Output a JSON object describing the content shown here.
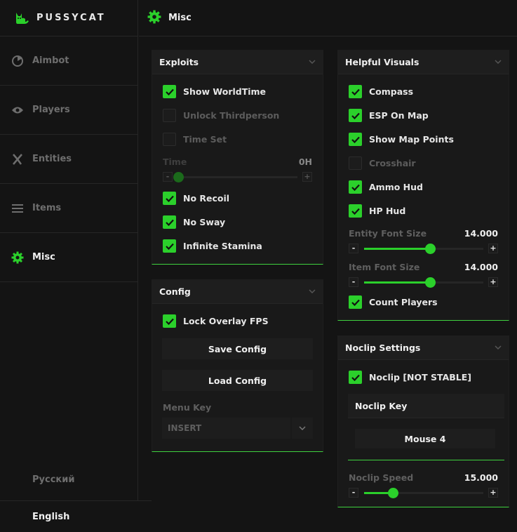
{
  "app": {
    "name": "PUSSYCAT",
    "accent": "#2bd02b"
  },
  "sidebar": {
    "items": [
      {
        "label": "Aimbot",
        "icon": "crosshair-icon"
      },
      {
        "label": "Players",
        "icon": "eye-icon"
      },
      {
        "label": "Entities",
        "icon": "entity-icon"
      },
      {
        "label": "Items",
        "icon": "list-icon"
      },
      {
        "label": "Misc",
        "icon": "gear-icon"
      }
    ],
    "languages": [
      "Русский",
      "English"
    ]
  },
  "header": {
    "title": "Misc"
  },
  "exploits": {
    "title": "Exploits",
    "show_worldtime": "Show WorldTime",
    "unlock_thirdperson": "Unlock Thirdperson",
    "time_set": "Time Set",
    "time_label": "Time",
    "time_value": "0H",
    "time_level": 0,
    "no_recoil": "No Recoil",
    "no_sway": "No Sway",
    "infinite_stamina": "Infinite Stamina"
  },
  "config": {
    "title": "Config",
    "lock_overlay_fps": "Lock Overlay FPS",
    "save_config": "Save Config",
    "load_config": "Load Config",
    "menu_key_label": "Menu Key",
    "menu_key_value": "INSERT"
  },
  "visuals": {
    "title": "Helpful Visuals",
    "compass": "Compass",
    "esp_on_map": "ESP On Map",
    "show_map_points": "Show Map Points",
    "crosshair": "Crosshair",
    "ammo_hud": "Ammo Hud",
    "hp_hud": "HP Hud",
    "entity_font_label": "Entity Font Size",
    "entity_font_value": "14.000",
    "entity_font_level": 0.55,
    "item_font_label": "Item Font Size",
    "item_font_value": "14.000",
    "item_font_level": 0.55,
    "count_players": "Count Players"
  },
  "noclip": {
    "title": "Noclip Settings",
    "noclip_toggle": "Noclip [NOT STABLE]",
    "key_title": "Noclip Key",
    "key_value": "Mouse 4",
    "speed_label": "Noclip Speed",
    "speed_value": "15.000",
    "speed_level": 0.24
  },
  "controls": {
    "minus": "-",
    "plus": "+"
  }
}
